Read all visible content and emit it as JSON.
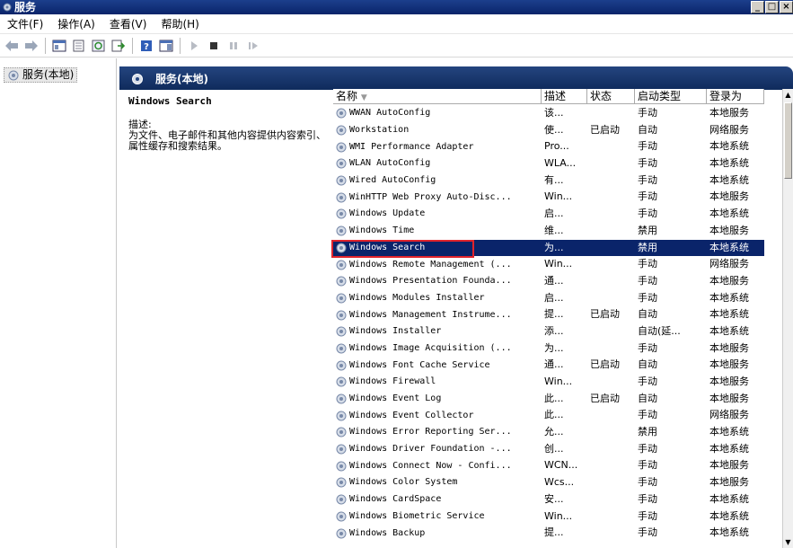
{
  "window": {
    "title": "服务",
    "min": "_",
    "max": "□",
    "close": "×"
  },
  "menu": [
    "文件(F)",
    "操作(A)",
    "查看(V)",
    "帮助(H)"
  ],
  "tree": {
    "label": "服务(本地)"
  },
  "pane": {
    "title": "服务(本地)"
  },
  "desc": {
    "service_title": "Windows Search",
    "label": "描述:",
    "text": "为文件、电子邮件和其他内容提供内容索引、属性缓存和搜索结果。"
  },
  "columns": [
    "名称",
    "描述",
    "状态",
    "启动类型",
    "登录为"
  ],
  "rows": [
    {
      "name": "WWAN AutoConfig",
      "desc": "该...",
      "status": "",
      "startup": "手动",
      "logon": "本地服务"
    },
    {
      "name": "Workstation",
      "desc": "使...",
      "status": "已启动",
      "startup": "自动",
      "logon": "网络服务"
    },
    {
      "name": "WMI Performance Adapter",
      "desc": "Pro...",
      "status": "",
      "startup": "手动",
      "logon": "本地系统"
    },
    {
      "name": "WLAN AutoConfig",
      "desc": "WLA...",
      "status": "",
      "startup": "手动",
      "logon": "本地系统"
    },
    {
      "name": "Wired AutoConfig",
      "desc": "有...",
      "status": "",
      "startup": "手动",
      "logon": "本地系统"
    },
    {
      "name": "WinHTTP Web Proxy Auto-Disc...",
      "desc": "Win...",
      "status": "",
      "startup": "手动",
      "logon": "本地服务"
    },
    {
      "name": "Windows Update",
      "desc": "启...",
      "status": "",
      "startup": "手动",
      "logon": "本地系统"
    },
    {
      "name": "Windows Time",
      "desc": "维...",
      "status": "",
      "startup": "禁用",
      "logon": "本地服务"
    },
    {
      "name": "Windows Search",
      "desc": "为...",
      "status": "",
      "startup": "禁用",
      "logon": "本地系统",
      "selected": true
    },
    {
      "name": "Windows Remote Management (...",
      "desc": "Win...",
      "status": "",
      "startup": "手动",
      "logon": "网络服务"
    },
    {
      "name": "Windows Presentation Founda...",
      "desc": "通...",
      "status": "",
      "startup": "手动",
      "logon": "本地服务"
    },
    {
      "name": "Windows Modules Installer",
      "desc": "启...",
      "status": "",
      "startup": "手动",
      "logon": "本地系统"
    },
    {
      "name": "Windows Management Instrume...",
      "desc": "提...",
      "status": "已启动",
      "startup": "自动",
      "logon": "本地系统"
    },
    {
      "name": "Windows Installer",
      "desc": "添...",
      "status": "",
      "startup": "自动(延...",
      "logon": "本地系统"
    },
    {
      "name": "Windows Image Acquisition (...",
      "desc": "为...",
      "status": "",
      "startup": "手动",
      "logon": "本地服务"
    },
    {
      "name": "Windows Font Cache Service",
      "desc": "通...",
      "status": "已启动",
      "startup": "自动",
      "logon": "本地服务"
    },
    {
      "name": "Windows Firewall",
      "desc": "Win...",
      "status": "",
      "startup": "手动",
      "logon": "本地服务"
    },
    {
      "name": "Windows Event Log",
      "desc": "此...",
      "status": "已启动",
      "startup": "自动",
      "logon": "本地服务"
    },
    {
      "name": "Windows Event Collector",
      "desc": "此...",
      "status": "",
      "startup": "手动",
      "logon": "网络服务"
    },
    {
      "name": "Windows Error Reporting Ser...",
      "desc": "允...",
      "status": "",
      "startup": "禁用",
      "logon": "本地系统"
    },
    {
      "name": "Windows Driver Foundation -...",
      "desc": "创...",
      "status": "",
      "startup": "手动",
      "logon": "本地系统"
    },
    {
      "name": "Windows Connect Now - Confi...",
      "desc": "WCN...",
      "status": "",
      "startup": "手动",
      "logon": "本地服务"
    },
    {
      "name": "Windows Color System",
      "desc": "Wcs...",
      "status": "",
      "startup": "手动",
      "logon": "本地服务"
    },
    {
      "name": "Windows CardSpace",
      "desc": "安...",
      "status": "",
      "startup": "手动",
      "logon": "本地系统"
    },
    {
      "name": "Windows Biometric Service",
      "desc": "Win...",
      "status": "",
      "startup": "手动",
      "logon": "本地系统"
    },
    {
      "name": "Windows Backup",
      "desc": "提...",
      "status": "",
      "startup": "手动",
      "logon": "本地系统"
    }
  ]
}
